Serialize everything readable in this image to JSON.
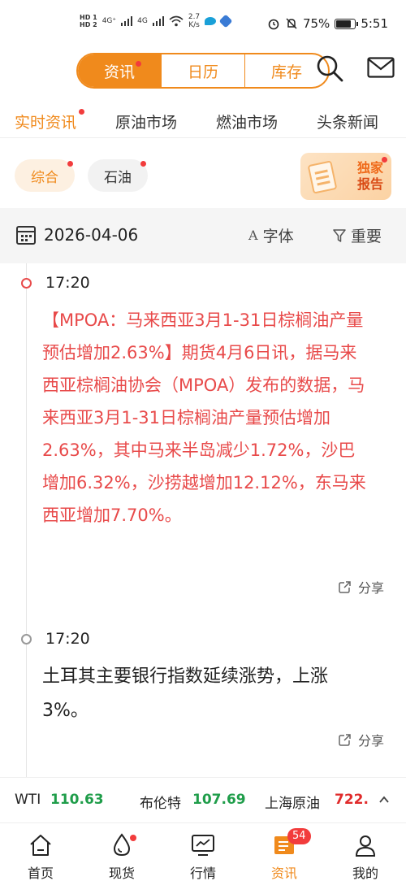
{
  "status_bar": {
    "hd1": "HD 1",
    "hd2": "HD 2",
    "net1": "4G⁺",
    "net2": "4G",
    "speed_value": "2.7",
    "speed_unit": "K/s",
    "battery": "75%",
    "time": "5:51"
  },
  "header": {
    "segments": [
      "资讯",
      "日历",
      "库存"
    ],
    "active_segment": "资讯"
  },
  "tabs": [
    "实时资讯",
    "原油市场",
    "燃油市场",
    "头条新闻"
  ],
  "filters": {
    "chips": [
      "综合",
      "石油"
    ],
    "exclusive_line1": "独家",
    "exclusive_line2": "报告"
  },
  "date_bar": {
    "date": "2026-04-06",
    "font_label": "字体",
    "font_icon_text": "A",
    "important_label": "重要"
  },
  "news": [
    {
      "time": "17:20",
      "text": "【MPOA：马来西亚3月1-31日棕榈油产量预估增加2.63%】期货4月6日讯，据马来西亚棕榈油协会（MPOA）发布的数据，马来西亚3月1-31日棕榈油产量预估增加2.63%，其中马来半岛减少1.72%，沙巴增加6.32%，沙捞越增加12.12%，东马来西亚增加7.70%。",
      "share": "分享"
    },
    {
      "time": "17:20",
      "text": "土耳其主要银行指数延续涨势，上涨3%。",
      "share": "分享"
    }
  ],
  "ticker": [
    {
      "name": "WTI",
      "value": "110.63",
      "color": "#1f9d4a"
    },
    {
      "name": "布伦特",
      "value": "107.69",
      "color": "#1f9d4a"
    },
    {
      "name": "上海原油",
      "value": "722.",
      "color": "#e02b2b"
    }
  ],
  "bottom_nav": {
    "items": [
      "首页",
      "现货",
      "行情",
      "资讯",
      "我的"
    ],
    "active": "资讯",
    "badge": "54"
  },
  "colors": {
    "accent": "#f08a1c",
    "news_red": "#e84a4a",
    "up_green": "#1f9d4a",
    "down_red": "#e02b2b"
  }
}
